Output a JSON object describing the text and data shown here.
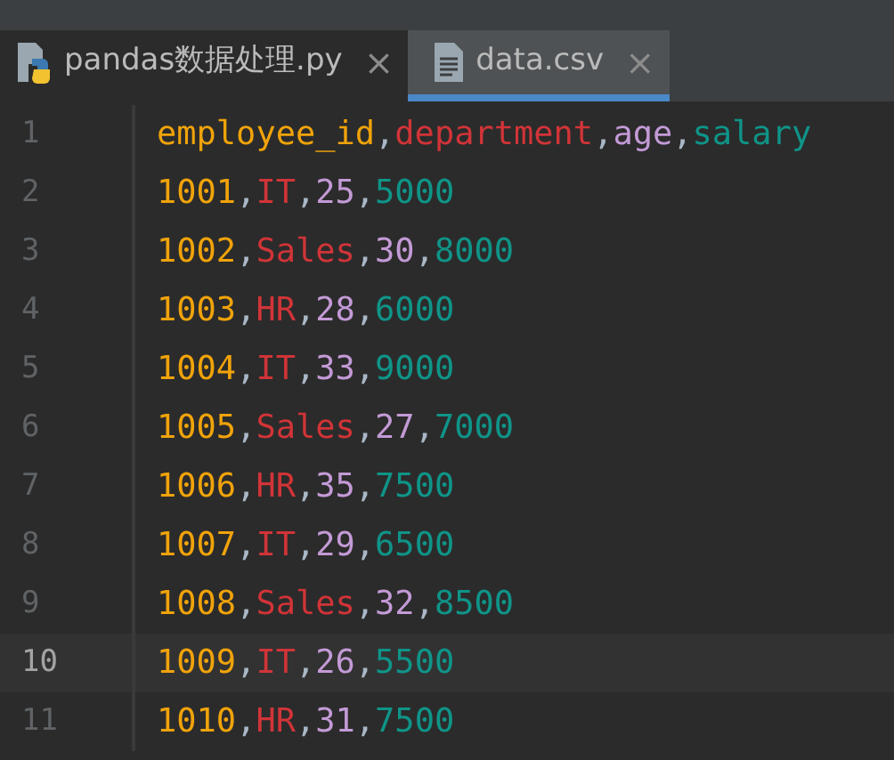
{
  "tabs": [
    {
      "kind": "python",
      "label": "pandas数据处理.py",
      "close": "×",
      "selected": false
    },
    {
      "kind": "text",
      "label": "data.csv",
      "close": "×",
      "selected": true
    }
  ],
  "editor": {
    "delimiter": ",",
    "lines": [
      {
        "number": "1",
        "current": false,
        "cells": [
          "employee_id",
          "department",
          "age",
          "salary"
        ]
      },
      {
        "number": "2",
        "current": false,
        "cells": [
          "1001",
          "IT",
          "25",
          "5000"
        ]
      },
      {
        "number": "3",
        "current": false,
        "cells": [
          "1002",
          "Sales",
          "30",
          "8000"
        ]
      },
      {
        "number": "4",
        "current": false,
        "cells": [
          "1003",
          "HR",
          "28",
          "6000"
        ]
      },
      {
        "number": "5",
        "current": false,
        "cells": [
          "1004",
          "IT",
          "33",
          "9000"
        ]
      },
      {
        "number": "6",
        "current": false,
        "cells": [
          "1005",
          "Sales",
          "27",
          "7000"
        ]
      },
      {
        "number": "7",
        "current": false,
        "cells": [
          "1006",
          "HR",
          "35",
          "7500"
        ]
      },
      {
        "number": "8",
        "current": false,
        "cells": [
          "1007",
          "IT",
          "29",
          "6500"
        ]
      },
      {
        "number": "9",
        "current": false,
        "cells": [
          "1008",
          "Sales",
          "32",
          "8500"
        ]
      },
      {
        "number": "10",
        "current": true,
        "cells": [
          "1009",
          "IT",
          "26",
          "5500"
        ]
      },
      {
        "number": "11",
        "current": false,
        "cells": [
          "1010",
          "HR",
          "31",
          "7500"
        ]
      }
    ]
  }
}
